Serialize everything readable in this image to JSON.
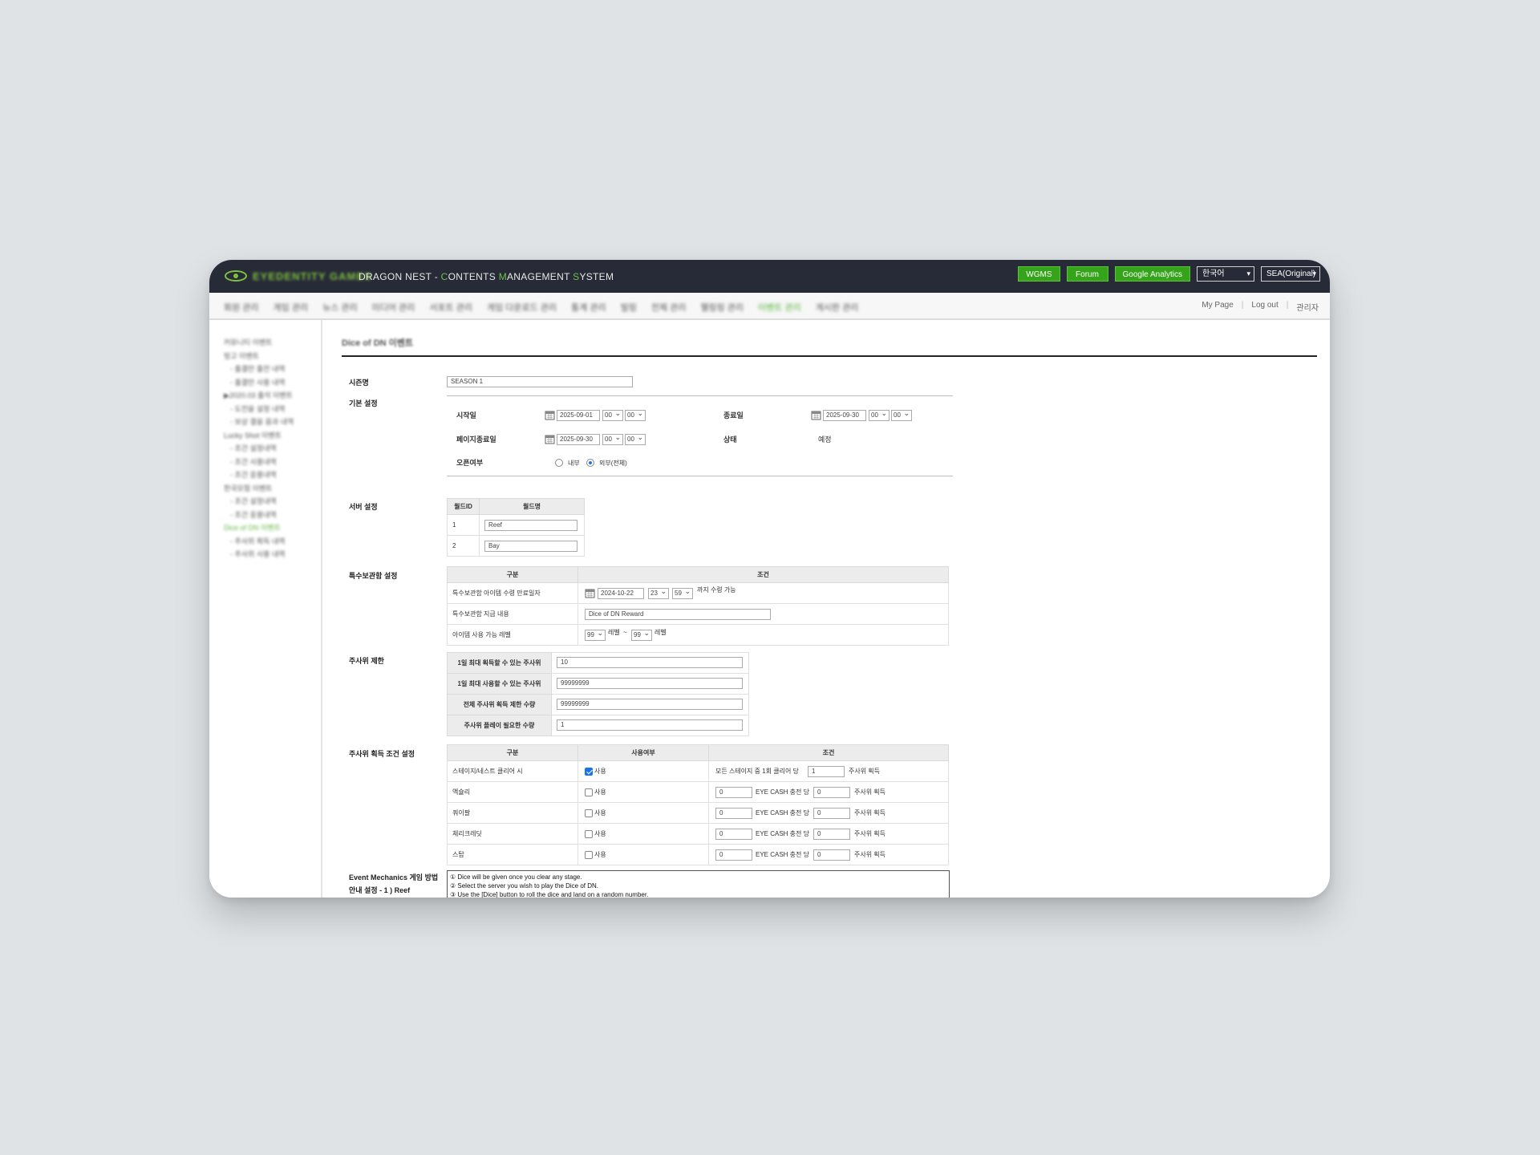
{
  "header": {
    "logo_text": "EYEDENTITY GAMES",
    "title": "DRAGON NEST - CONTENTS MANAGEMENT SYSTEM",
    "buttons": [
      "WGMS",
      "Forum",
      "Google Analytics"
    ],
    "language": "한국어",
    "region": "SEA(Original)"
  },
  "nav": {
    "items": [
      "회원 관리",
      "게임 관리",
      "뉴스 관리",
      "미디어 관리",
      "서포트 관리",
      "게임 다운로드 관리",
      "통계 관리",
      "빌링",
      "전체 관리",
      "웰링링 관리",
      "이벤트 관리",
      "게시판 관리"
    ],
    "active_index": 10,
    "right": [
      "My Page",
      "Log out",
      "관리자"
    ]
  },
  "sidebar": {
    "items": [
      {
        "label": "커뮤니티 이벤트",
        "sub": false
      },
      {
        "label": "빙고 이벤트",
        "sub": false
      },
      {
        "label": "- 출결만 출전 내역",
        "sub": true
      },
      {
        "label": "- 출결만 사용 내역",
        "sub": true
      },
      {
        "label": "▶2020.03 출석 이벤트",
        "sub": false
      },
      {
        "label": "- 도전을 설정 내역",
        "sub": true
      },
      {
        "label": "- 보상 결을 음과 내역",
        "sub": true
      },
      {
        "label": "Lucky Shot 이벤트",
        "sub": false
      },
      {
        "label": "- 조건 설정내역",
        "sub": true
      },
      {
        "label": "- 조건 사용내역",
        "sub": true
      },
      {
        "label": "- 조건 응용내역",
        "sub": true
      },
      {
        "label": "한국모험 이벤트",
        "sub": false
      },
      {
        "label": "- 조건 설정내역",
        "sub": true
      },
      {
        "label": "- 조건 응용내역",
        "sub": true
      },
      {
        "label": "Dice of DN 이벤트",
        "sub": false,
        "active": true
      },
      {
        "label": "- 주사위 획득 내역",
        "sub": true
      },
      {
        "label": "- 주사위 사용 내역",
        "sub": true
      }
    ]
  },
  "page": {
    "title": "Dice of DN 이벤트",
    "season": {
      "label": "시즌명",
      "value": "SEASON 1"
    },
    "basic": {
      "label": "기본 설정",
      "start_label": "시작일",
      "start_date": "2025-09-01",
      "start_h": "00",
      "start_m": "00",
      "end_label": "종료일",
      "end_date": "2025-09-30",
      "end_h": "00",
      "end_m": "00",
      "page_end_label": "페이지종료일",
      "page_end_date": "2025-09-30",
      "page_end_h": "00",
      "page_end_m": "00",
      "status_label": "상태",
      "status_value": "예정",
      "open_label": "오픈여부",
      "open_internal": "내부",
      "open_external": "외부(전체)"
    },
    "server": {
      "label": "서버 설정",
      "headers": [
        "월드ID",
        "월드명"
      ],
      "rows": [
        {
          "id": "1",
          "name": "Reef"
        },
        {
          "id": "2",
          "name": "Bay"
        }
      ]
    },
    "special": {
      "label": "특수보관함 설정",
      "headers": [
        "구분",
        "조건"
      ],
      "row1_label": "특수보관함 아이템 수령 만료일자",
      "row1_date": "2024-10-22",
      "row1_h": "23",
      "row1_m": "59",
      "row1_suffix": "까지 수령 가능",
      "row2_label": "특수보관함 지급 내용",
      "row2_value": "Dice of DN Reward",
      "row3_label": "아이템 사용 가능 레벨",
      "row3_min": "99",
      "row3_unit1": "레벨",
      "row3_tilde": "~",
      "row3_max": "99",
      "row3_unit2": "레벨"
    },
    "dice_limit": {
      "label": "주사위 제한",
      "rows": [
        {
          "label": "1일 최대 획득할 수 있는 주사위",
          "value": "10"
        },
        {
          "label": "1일 최대 사용할 수 있는 주사위",
          "value": "99999999"
        },
        {
          "label": "전체 주사위 획득 제한 수량",
          "value": "99999999"
        },
        {
          "label": "주사위 플레이 필요한 수량",
          "value": "1"
        }
      ]
    },
    "dice_cond": {
      "label": "주사위 획득 조건 설정",
      "headers": [
        "구분",
        "사용여부",
        "조건"
      ],
      "use_label": "사용",
      "row1": {
        "name": "스테이지/네스트 클리어 시",
        "checked": true,
        "pre": "모든 스테이지 중 1회 클리어 당",
        "value": "1",
        "post": "주사위 획득"
      },
      "cash_rows": [
        {
          "name": "액슐리",
          "a": "0",
          "b": "0"
        },
        {
          "name": "쿼이팔",
          "a": "0",
          "b": "0"
        },
        {
          "name": "체리크레딧",
          "a": "0",
          "b": "0"
        },
        {
          "name": "스탑",
          "a": "0",
          "b": "0"
        }
      ],
      "cash_mid": "EYE CASH 충전 당",
      "cash_post": "주사위 획득"
    },
    "mechanics": {
      "label_line1": "Event Mechanics 게임 방법",
      "label_line2": "안내 설정 - 1 ) Reef",
      "lines": [
        "① Dice will be given once you clear any stage.",
        "② Select the server you wish to play the Dice of DN.",
        "③ Use the [Dice] button to roll the dice and land on a random number."
      ]
    }
  }
}
